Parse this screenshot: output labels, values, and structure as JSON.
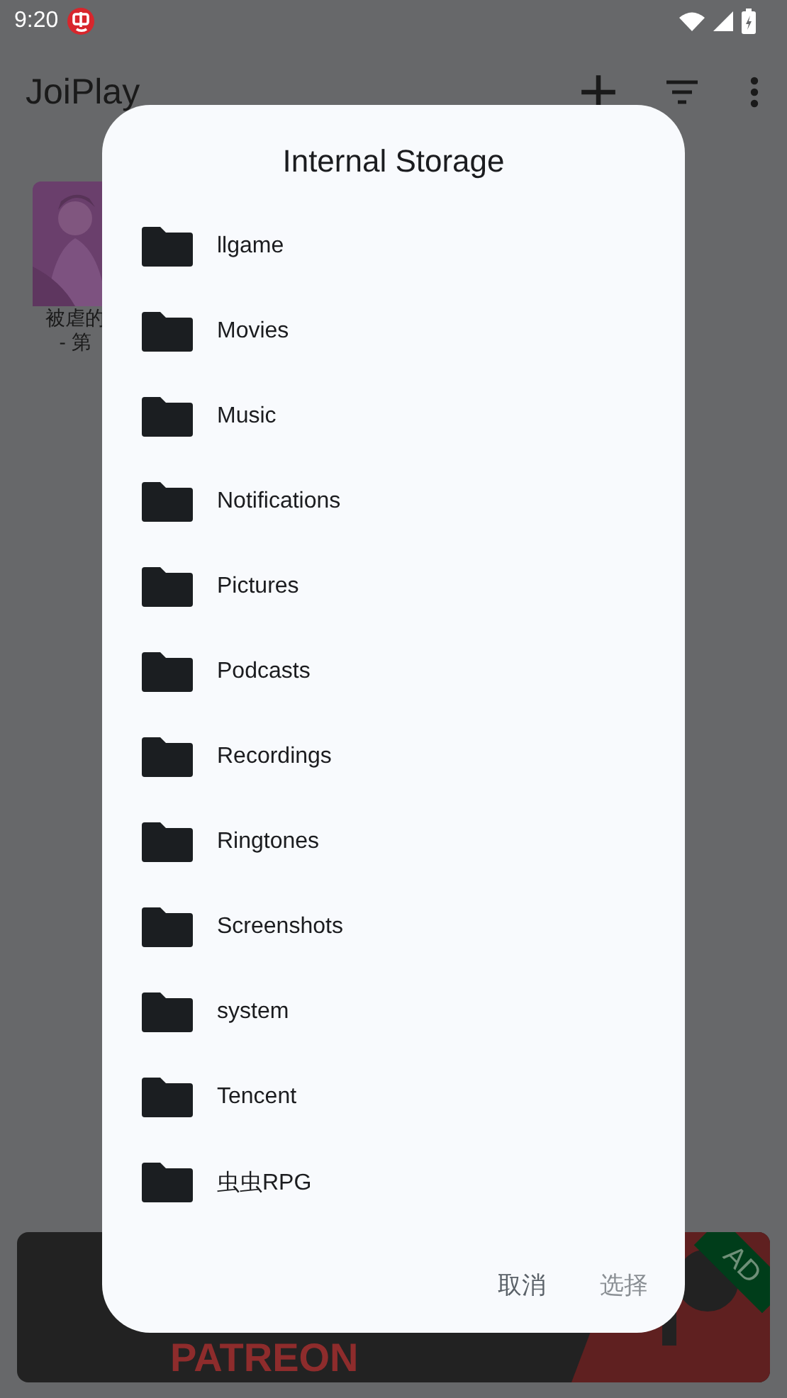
{
  "status_bar": {
    "time": "9:20"
  },
  "app_bar": {
    "title": "JoiPlay"
  },
  "games": [
    {
      "title_lines": [
        "被虐的",
        "- 第"
      ]
    }
  ],
  "ad_banner": {
    "text": "PATREON",
    "badge": "AD"
  },
  "dialog": {
    "title": "Internal Storage",
    "folders": [
      {
        "name": "llgame"
      },
      {
        "name": "Movies"
      },
      {
        "name": "Music"
      },
      {
        "name": "Notifications"
      },
      {
        "name": "Pictures"
      },
      {
        "name": "Podcasts"
      },
      {
        "name": "Recordings"
      },
      {
        "name": "Ringtones"
      },
      {
        "name": "Screenshots"
      },
      {
        "name": "system"
      },
      {
        "name": "Tencent"
      },
      {
        "name": "虫虫RPG"
      }
    ],
    "buttons": [
      {
        "label": "取消",
        "disabled": false
      },
      {
        "label": "选择",
        "disabled": true
      }
    ]
  }
}
